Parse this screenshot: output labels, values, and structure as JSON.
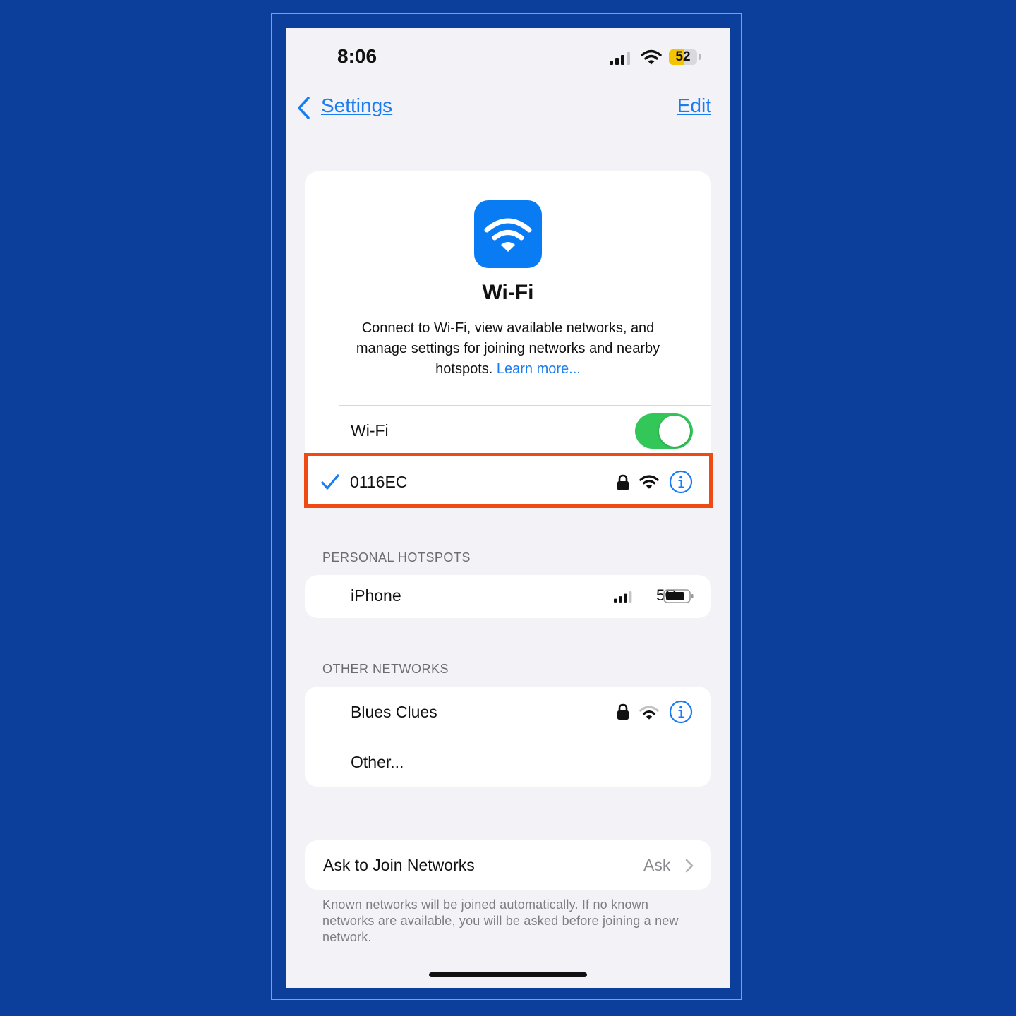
{
  "status_bar": {
    "time": "8:06",
    "battery": "52",
    "battery_level_percent": 52,
    "icons": [
      "cellular-signal-icon",
      "wifi-icon",
      "battery-icon"
    ]
  },
  "nav": {
    "back_label": "Settings",
    "edit_label": "Edit"
  },
  "header": {
    "icon": "wifi-icon",
    "title": "Wi-Fi",
    "description": "Connect to Wi-Fi, view available networks, and manage settings for joining networks and nearby hotspots. ",
    "learn_more": "Learn more..."
  },
  "wifi_toggle": {
    "label": "Wi-Fi",
    "on": true
  },
  "current_network": {
    "name": "0116EC",
    "connected": true,
    "secured": true,
    "icons": [
      "checkmark-icon",
      "lock-icon",
      "wifi-icon",
      "info-icon"
    ]
  },
  "personal_hotspots": {
    "header": "PERSONAL HOTSPOTS",
    "items": [
      {
        "name": "iPhone",
        "network_type": "5G",
        "icons": [
          "cellular-signal-icon",
          "battery-icon"
        ]
      }
    ]
  },
  "other_networks": {
    "header": "OTHER NETWORKS",
    "items": [
      {
        "name": "Blues Clues",
        "secured": true,
        "icons": [
          "lock-icon",
          "wifi-icon",
          "info-icon"
        ]
      }
    ],
    "other_label": "Other..."
  },
  "ask_to_join": {
    "label": "Ask to Join Networks",
    "value": "Ask",
    "footer": "Known networks will be joined automatically. If no known networks are available, you will be asked before joining a new network."
  },
  "colors": {
    "accent": "#1a7cf2",
    "toggle_on": "#33c659",
    "highlight": "#f04a14",
    "background": "#0c3f9c",
    "battery_fill": "#f5c400"
  }
}
